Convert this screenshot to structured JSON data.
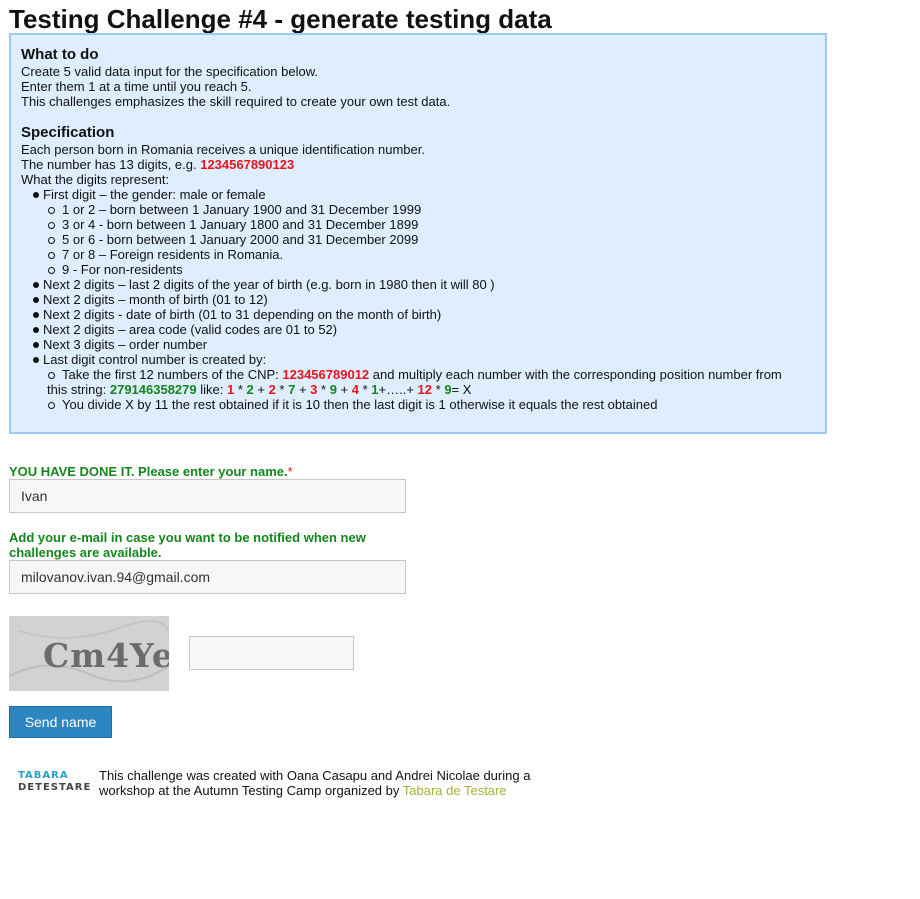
{
  "page": {
    "title": "Testing Challenge #4 - generate testing data"
  },
  "what_to_do": {
    "heading": "What to do",
    "lines": [
      "Create 5 valid data input for the specification below.",
      "Enter them 1 at a time until you reach 5.",
      "This challenges emphasizes the skill required to create your own test data."
    ]
  },
  "spec": {
    "heading": "Specification",
    "intro1": "Each person born in Romania receives a unique identification number.",
    "intro2_prefix": "The number has 13 digits, e.g. ",
    "intro2_example": "1234567890123",
    "intro3": "What the digits represent:",
    "first_digit": "First digit – the gender: male or female",
    "first_digit_sub": [
      "1 or 2 – born between 1 January 1900 and 31 December 1999",
      "3 or 4 - born between 1 January 1800 and 31 December 1899",
      "5 or 6 - born between 1 January 2000 and 31 December 2099",
      "7 or 8 – Foreign residents in Romania.",
      "9 - For non-residents"
    ],
    "next_items": [
      "Next 2 digits – last 2 digits of the year of birth (e.g. born in 1980 then it will 80 )",
      "Next 2 digits – month of birth (01 to 12)",
      "Next 2 digits - date of birth (01 to 31 depending on the month of birth)",
      "Next 2 digits – area code (valid codes are 01 to 52)",
      "Next 3 digits – order number"
    ],
    "last_digit": "Last digit control number is created by:",
    "take_prefix": "Take the first 12 numbers of the CNP: ",
    "take_cnp": "123456789012",
    "take_mid": " and multiply each number with the corresponding position number from",
    "this_string_prefix": "this string: ",
    "this_string": "279146358279",
    "like": " like: ",
    "formula": [
      {
        "a": "1",
        "b": "2"
      },
      {
        "a": "2",
        "b": "7"
      },
      {
        "a": "3",
        "b": "9"
      },
      {
        "a": "4",
        "b": "1"
      }
    ],
    "formula_dots": "+…..+ ",
    "formula_last_a": "12",
    "formula_last_b": "9",
    "formula_end": "= X",
    "divide": "You divide X by 11 the rest obtained if it is 10 then the last digit is 1 otherwise it equals the rest obtained"
  },
  "form": {
    "name_label": "YOU HAVE DONE IT. Please enter your name.",
    "required_mark": "*",
    "name_value": "Ivan",
    "email_label_1": "Add your e-mail in case you want to be notified when new",
    "email_label_2": "challenges are available.",
    "email_value": "milovanov.ivan.94@gmail.com",
    "captcha_text": "Cm4Ye",
    "captcha_value": "",
    "submit_label": "Send name"
  },
  "footer": {
    "logo_top": "TABARA",
    "logo_bottom": "DETESTARE",
    "text1": "This challenge was created with Oana Casapu and Andrei Nicolae during a",
    "text2": "workshop at the Autumn Testing Camp organized by ",
    "link": "Tabara de Testare"
  },
  "colors": {
    "panel_bg": "#deeefe",
    "panel_border": "#9ccaf2",
    "red": "#e8141d",
    "green": "#13861c",
    "button_bg": "#2e86c1",
    "link": "#a8b03a"
  }
}
